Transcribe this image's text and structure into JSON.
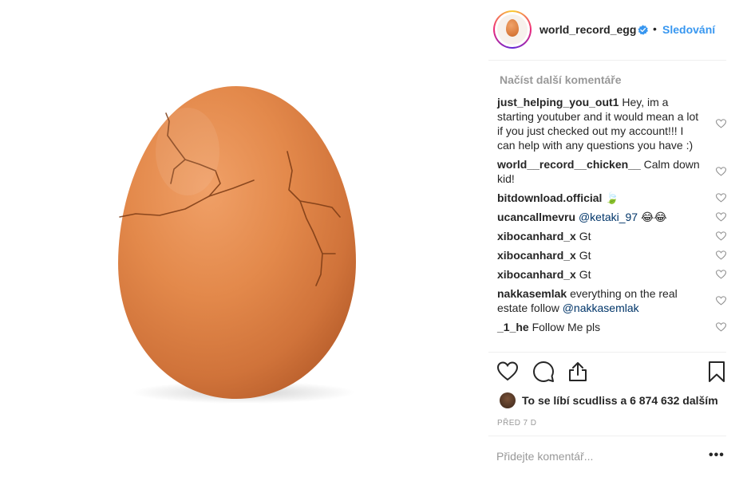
{
  "header": {
    "username": "world_record_egg",
    "separator": "•",
    "follow_label": "Sledování"
  },
  "comments": {
    "load_more": "Načíst další komentáře",
    "items": [
      {
        "user": "just_helping_you_out1",
        "text": " Hey, im a starting youtuber and it would mean a lot if you just checked out my account!!! I can help with any questions you have :)"
      },
      {
        "user": "world__record__chicken__",
        "text": " Calm down kid!"
      },
      {
        "user": "bitdownload.official",
        "text": " 🍃"
      },
      {
        "user": "ucancallmevru",
        "mention": " @ketaki_97",
        "text": " 😂😂"
      },
      {
        "user": "xibocanhard_x",
        "text": " Gt"
      },
      {
        "user": "xibocanhard_x",
        "text": " Gt"
      },
      {
        "user": "xibocanhard_x",
        "text": " Gt"
      },
      {
        "user": "nakkasemlak",
        "text": " everything on the real estate follow ",
        "mention": "@nakkasemlak"
      },
      {
        "user": "_1_he",
        "text": " Follow Me pls"
      }
    ]
  },
  "actions": {
    "like_icon": "heart-icon",
    "comment_icon": "comment-icon",
    "share_icon": "share-icon",
    "save_icon": "bookmark-icon"
  },
  "likes": {
    "text": "To se líbí scudliss a 6 874 632 dalším"
  },
  "timestamp": "PŘED 7 D",
  "add_comment": {
    "placeholder": "Přidejte komentář..."
  },
  "more_options": "•••",
  "colors": {
    "link": "#3897f0",
    "mention": "#003569",
    "muted": "#999999",
    "egg": "#e1874a"
  }
}
